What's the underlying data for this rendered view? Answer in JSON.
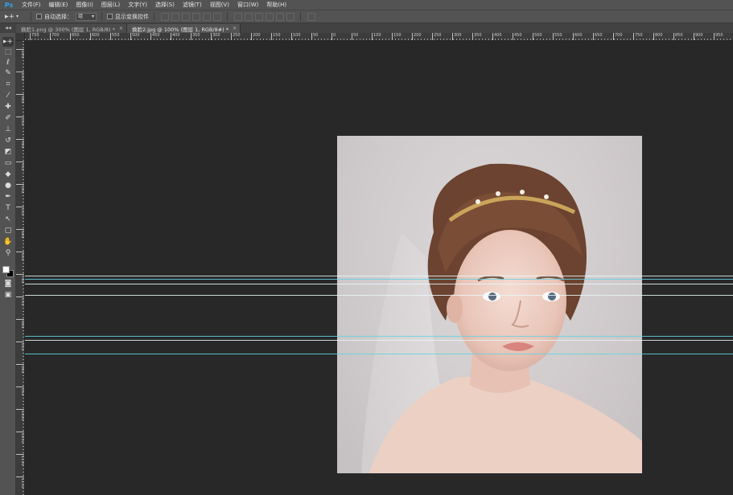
{
  "app": {
    "logo": "Ps"
  },
  "menu": [
    "文件(F)",
    "编辑(E)",
    "图像(I)",
    "图层(L)",
    "文字(Y)",
    "选择(S)",
    "滤镜(T)",
    "视图(V)",
    "窗口(W)",
    "帮助(H)"
  ],
  "options": {
    "tool_glyph": "▸+",
    "auto_select_label": "自动选择：",
    "auto_select_value": "组",
    "show_transform_label": "显示变换控件"
  },
  "tabs": [
    {
      "label": "换脸1.png @ 300% (图层 1, RGB/8) *",
      "close": "×"
    },
    {
      "label": "换脸2.jpg @ 100% (图层 1, RGB/8#) *",
      "close": "×"
    }
  ],
  "ruler": {
    "top_labels": [
      "750",
      "700",
      "650",
      "600",
      "550",
      "500",
      "450",
      "400",
      "350",
      "300",
      "250",
      "200",
      "150",
      "100",
      "50",
      "0",
      "50",
      "100",
      "150",
      "200",
      "250",
      "300",
      "350",
      "400",
      "450",
      "500",
      "550",
      "600",
      "650",
      "700",
      "750",
      "800",
      "850",
      "900",
      "950",
      "1000"
    ],
    "left_labels": [
      "200",
      "250",
      "300",
      "350",
      "400",
      "450",
      "500",
      "550",
      "600",
      "650",
      "700",
      "750",
      "800",
      "850",
      "900",
      "950",
      "1000",
      "1050",
      "1100",
      "1150"
    ]
  },
  "toolbar": {
    "collapse": "◂◂",
    "tools": [
      {
        "name": "move-tool-icon",
        "glyph": "▸+"
      },
      {
        "name": "marquee-tool-icon",
        "glyph": "⬚"
      },
      {
        "name": "lasso-tool-icon",
        "glyph": "ℓ"
      },
      {
        "name": "quick-select-tool-icon",
        "glyph": "✎"
      },
      {
        "name": "crop-tool-icon",
        "glyph": "⌗"
      },
      {
        "name": "eyedropper-tool-icon",
        "glyph": "⁄"
      },
      {
        "name": "healing-brush-tool-icon",
        "glyph": "✚"
      },
      {
        "name": "brush-tool-icon",
        "glyph": "✐"
      },
      {
        "name": "clone-stamp-tool-icon",
        "glyph": "⊥"
      },
      {
        "name": "history-brush-tool-icon",
        "glyph": "↺"
      },
      {
        "name": "eraser-tool-icon",
        "glyph": "◩"
      },
      {
        "name": "gradient-tool-icon",
        "glyph": "▭"
      },
      {
        "name": "blur-tool-icon",
        "glyph": "◆"
      },
      {
        "name": "dodge-tool-icon",
        "glyph": "●"
      },
      {
        "name": "pen-tool-icon",
        "glyph": "✒"
      },
      {
        "name": "type-tool-icon",
        "glyph": "T"
      },
      {
        "name": "path-select-tool-icon",
        "glyph": "↖"
      },
      {
        "name": "shape-tool-icon",
        "glyph": "▢"
      },
      {
        "name": "hand-tool-icon",
        "glyph": "✋"
      },
      {
        "name": "zoom-tool-icon",
        "glyph": "⚲"
      },
      {
        "name": "quick-mask-icon",
        "glyph": "◙"
      },
      {
        "name": "screen-mode-icon",
        "glyph": "▣"
      }
    ]
  },
  "colors": {
    "foreground": "#ffffff",
    "background": "#000000",
    "guide": "#5fd4e6"
  }
}
